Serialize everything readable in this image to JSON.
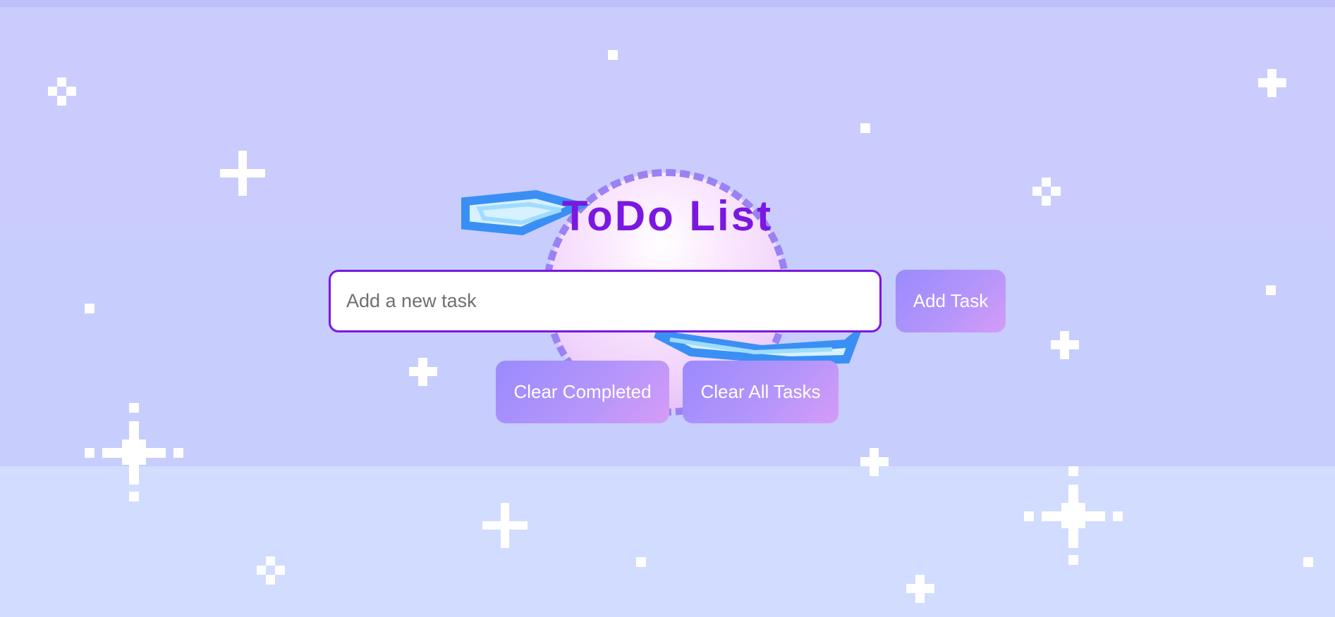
{
  "app": {
    "title": "ToDo List"
  },
  "input": {
    "placeholder": "Add a new task",
    "value": ""
  },
  "buttons": {
    "add": "Add Task",
    "clear_completed": "Clear Completed",
    "clear_all": "Clear All Tasks"
  },
  "colors": {
    "accent": "#7a18e0",
    "button_gradient_start": "#9b8afc",
    "button_gradient_end": "#d59cf6",
    "background": "#c9ccfd"
  },
  "decor": {
    "background_icons": [
      "planet-icon",
      "sparkle-icon"
    ]
  }
}
